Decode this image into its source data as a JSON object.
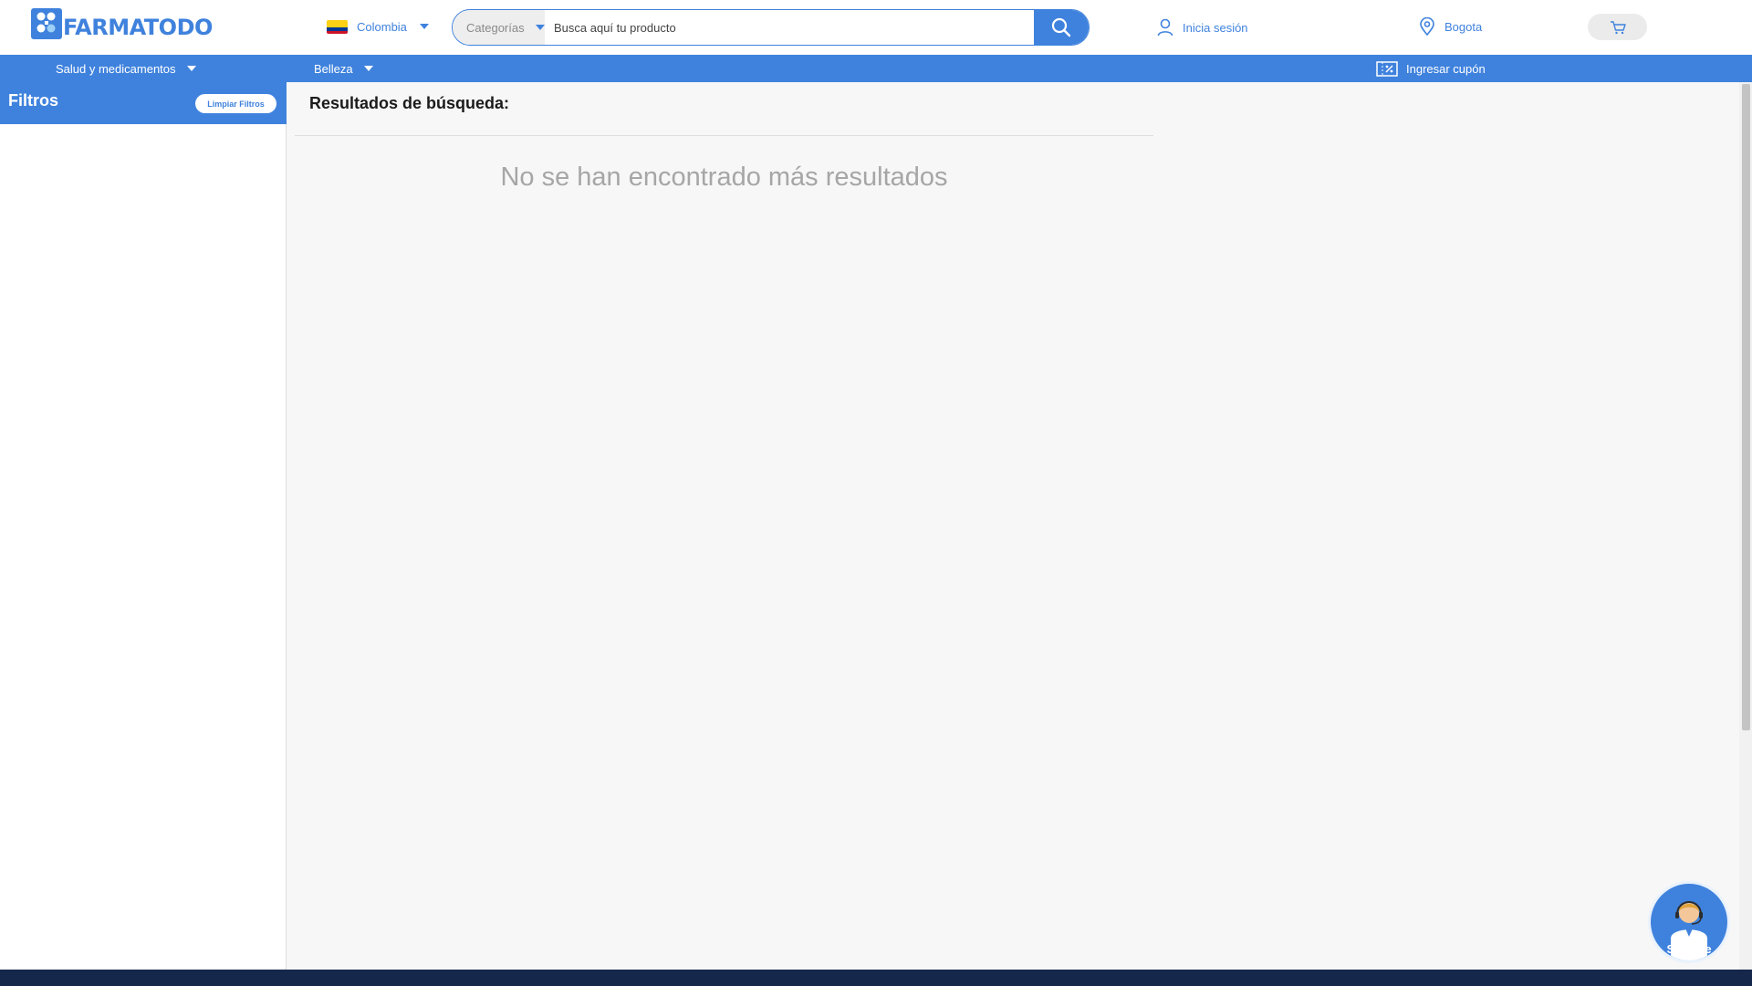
{
  "header": {
    "logo_text": "FARMATODO",
    "country": {
      "label": "Colombia",
      "flag_colors": [
        "#fcd116",
        "#003893",
        "#ce1126"
      ]
    },
    "search": {
      "category_label": "Categorías",
      "placeholder": "Busca aquí tu producto",
      "value": ""
    },
    "login_label": "Inicia sesión",
    "location_label": "Bogota",
    "icons": {
      "search": "search-icon",
      "user": "user-icon",
      "location": "location-pin-icon",
      "cart": "cart-icon"
    }
  },
  "nav": {
    "items": [
      {
        "label": "Salud y medicamentos"
      },
      {
        "label": "Belleza"
      }
    ],
    "coupon_label": "Ingresar cupón"
  },
  "sidebar": {
    "title": "Filtros",
    "clear_label": "Limpiar Filtros"
  },
  "main": {
    "results_title": "Resultados de búsqueda:",
    "empty_message": "No se han encontrado más resultados"
  },
  "support": {
    "label": "Soporte"
  },
  "colors": {
    "brand_blue": "#3f82dd",
    "footer_navy": "#15284b",
    "page_bg": "#f7f7f7"
  }
}
